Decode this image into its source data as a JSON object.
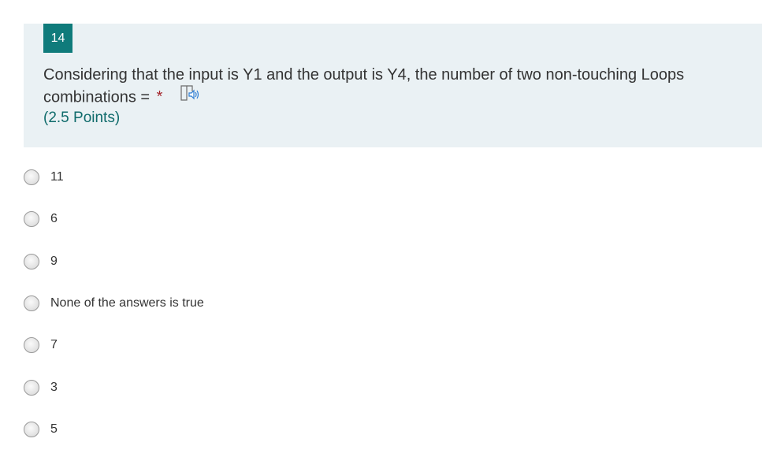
{
  "question": {
    "number": "14",
    "text": "Considering that the input is Y1 and the output is Y4, the number of two non-touching Loops combinations =",
    "required_marker": "*",
    "points": "(2.5 Points)"
  },
  "choices": [
    {
      "label": "11"
    },
    {
      "label": "6"
    },
    {
      "label": "9"
    },
    {
      "label": "None of the answers is true"
    },
    {
      "label": "7"
    },
    {
      "label": "3"
    },
    {
      "label": "5"
    }
  ],
  "colors": {
    "accent": "#0f7b7b",
    "card_background": "#eaf1f4",
    "required": "#a4262c"
  },
  "icons": {
    "reader": "immersive-reader-icon"
  }
}
